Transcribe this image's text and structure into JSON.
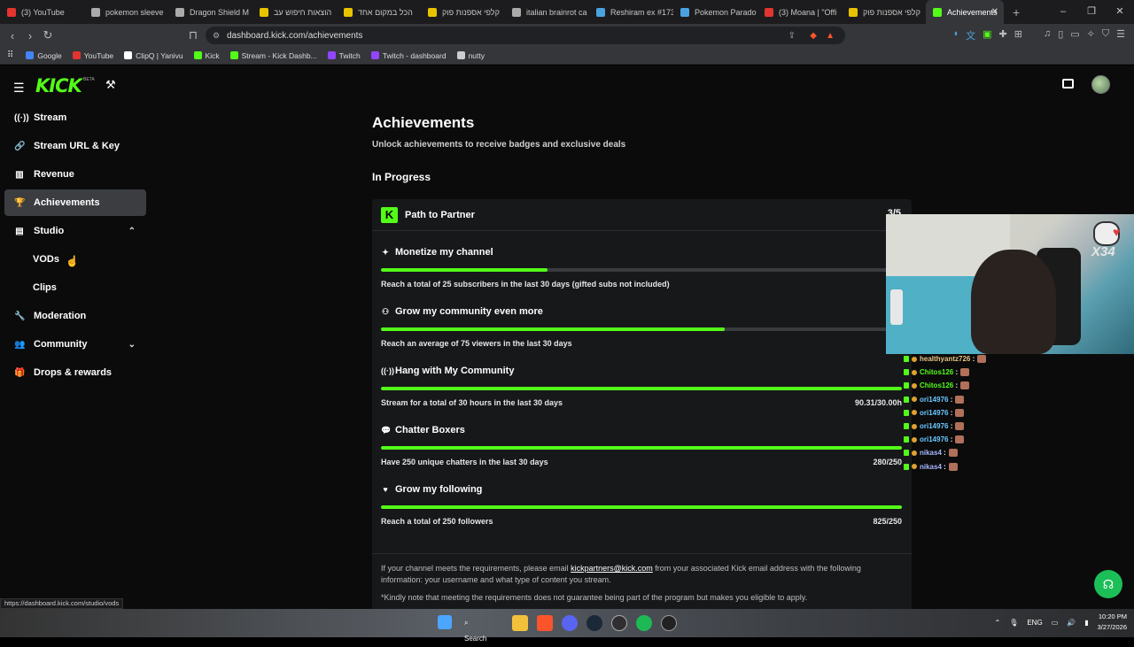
{
  "browser": {
    "tabs": [
      {
        "label": "(3) YouTube",
        "color": "#e3342f"
      },
      {
        "label": "pokemon sleeve",
        "color": "#aaaaaa"
      },
      {
        "label": "Dragon Shield M",
        "color": "#aaaaaa"
      },
      {
        "label": "הוצאות חיפוש עב",
        "color": "#e8c400"
      },
      {
        "label": "הכל במקום אחד",
        "color": "#e8c400"
      },
      {
        "label": "קלפי אספנות פוק",
        "color": "#e8c400"
      },
      {
        "label": "italian brainrot ca",
        "color": "#aaaaaa"
      },
      {
        "label": "Reshiram ex #173",
        "color": "#4aa3df"
      },
      {
        "label": "Pokemon Parado",
        "color": "#4aa3df"
      },
      {
        "label": "(3) Moana | \"Offi",
        "color": "#e3342f"
      },
      {
        "label": "קלפי אספנות פוק",
        "color": "#e8c400"
      },
      {
        "label": "Achievements",
        "color": "#53fc18",
        "active": true
      }
    ],
    "new_tab": "+",
    "window_controls": [
      "–",
      "❐",
      "✕"
    ],
    "url": "dashboard.kick.com/achievements",
    "bookmarks": [
      {
        "label": "Google",
        "color": "#4285f4"
      },
      {
        "label": "YouTube",
        "color": "#e3342f"
      },
      {
        "label": "ClipQ | Yanivu",
        "color": "#ffffff"
      },
      {
        "label": "Kick",
        "color": "#53fc18"
      },
      {
        "label": "Stream - Kick Dashb...",
        "color": "#53fc18"
      },
      {
        "label": "Twitch",
        "color": "#9146ff"
      },
      {
        "label": "Twitch - dashboard",
        "color": "#9146ff"
      },
      {
        "label": "nutty",
        "color": "#cccccc"
      }
    ],
    "status_url": "https://dashboard.kick.com/studio/vods"
  },
  "header": {
    "logo": "KICK",
    "beta": "BETA"
  },
  "sidebar": {
    "items": [
      {
        "label": "Stream",
        "icon": "broadcast-icon",
        "glyph": "((·))"
      },
      {
        "label": "Stream URL & Key",
        "icon": "link-icon",
        "glyph": "🔗"
      },
      {
        "label": "Revenue",
        "icon": "chart-icon",
        "glyph": "▥"
      },
      {
        "label": "Achievements",
        "icon": "trophy-icon",
        "glyph": "🏆",
        "active": true
      },
      {
        "label": "Studio",
        "icon": "film-icon",
        "glyph": "▤",
        "chevron": "⌃"
      },
      {
        "label": "VODs",
        "sub": true
      },
      {
        "label": "Clips",
        "sub": true
      },
      {
        "label": "Moderation",
        "icon": "wrench-icon",
        "glyph": "🔧"
      },
      {
        "label": "Community",
        "icon": "people-icon",
        "glyph": "👥",
        "chevron": "⌄"
      },
      {
        "label": "Drops & rewards",
        "icon": "gift-icon",
        "glyph": "🎁"
      }
    ]
  },
  "main": {
    "title": "Achievements",
    "subtitle": "Unlock achievements to receive badges and exclusive deals",
    "section": "In Progress",
    "card": {
      "title": "Path to Partner",
      "count": "3/5",
      "achievements": [
        {
          "name": "Monetize my channel",
          "icon": "sparkle-icon",
          "glyph": "✦",
          "description": "Reach a total of 25 subscribers in the last 30 days (gifted subs not included)",
          "value": "8",
          "progress": 0.32
        },
        {
          "name": "Grow my community even more",
          "icon": "group-icon",
          "glyph": "⚇",
          "description": "Reach an average of 75 viewers in the last 30 days",
          "value": "49.7",
          "progress": 0.66
        },
        {
          "name": "Hang with My Community",
          "icon": "radio-icon",
          "glyph": "((·))",
          "description": "Stream for a total of 30 hours in the last 30 days",
          "value": "90.31/30.00h",
          "progress": 1.0
        },
        {
          "name": "Chatter Boxers",
          "icon": "chat-icon",
          "glyph": "💬",
          "description": "Have 250 unique chatters in the last 30 days",
          "value": "280/250",
          "progress": 1.0
        },
        {
          "name": "Grow my following",
          "icon": "heart-icon",
          "glyph": "♥",
          "description": "Reach a total of 250 followers",
          "value": "825/250",
          "progress": 1.0
        }
      ],
      "footer_text_1": "If your channel meets the requirements, please email ",
      "footer_email": "kickpartners@kick.com",
      "footer_text_2": " from your associated Kick email address with the following information: your username and what type of content you stream.",
      "footer_note": "*Kindly note that meeting the requirements does not guarantee being part of the program but makes you eligible to apply."
    }
  },
  "overlay": {
    "stream_logo_text": "X34",
    "chat": [
      {
        "user": "healthyantz726",
        "color": "#e8c480"
      },
      {
        "user": "Chitos126",
        "color": "#53fc18"
      },
      {
        "user": "Chitos126",
        "color": "#53fc18"
      },
      {
        "user": "ori14976",
        "color": "#6ac8ff"
      },
      {
        "user": "ori14976",
        "color": "#6ac8ff"
      },
      {
        "user": "ori14976",
        "color": "#6ac8ff"
      },
      {
        "user": "ori14976",
        "color": "#6ac8ff"
      },
      {
        "user": "nikas4",
        "color": "#a6b8ff"
      },
      {
        "user": "nikas4",
        "color": "#a6b8ff"
      }
    ]
  },
  "taskbar": {
    "search": "Search",
    "lang": "ENG",
    "time": "10:20 PM",
    "date": "3/27/2026"
  },
  "colors": {
    "accent": "#53fc18",
    "background": "#0b0b0c",
    "card": "#17181a"
  }
}
